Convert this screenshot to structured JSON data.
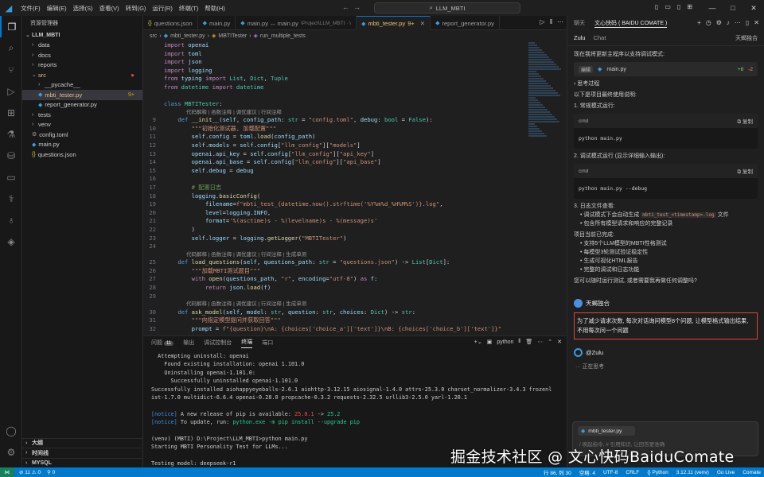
{
  "titlebar": {
    "menu": [
      "文件(F)",
      "编辑(E)",
      "选择(S)",
      "查看(V)",
      "转到(G)",
      "运行(R)",
      "终端(T)",
      "帮助(H)"
    ],
    "search": "LLM_MBTI",
    "window_controls": [
      "—",
      "□",
      "✕"
    ]
  },
  "sidebar": {
    "header": "资源管理器",
    "root": "LLM_MBTI",
    "items": [
      {
        "label": "data",
        "type": "folder",
        "depth": 1
      },
      {
        "label": "docs",
        "type": "folder",
        "depth": 1
      },
      {
        "label": "reports",
        "type": "folder",
        "depth": 1
      },
      {
        "label": "src",
        "type": "folder-open",
        "depth": 1,
        "modified": true
      },
      {
        "label": "__pycache__",
        "type": "folder",
        "depth": 2
      },
      {
        "label": "mbti_tester.py",
        "type": "py",
        "depth": 2,
        "badge": "9+",
        "selected": true
      },
      {
        "label": "report_generator.py",
        "type": "py",
        "depth": 2
      },
      {
        "label": "tests",
        "type": "folder",
        "depth": 1
      },
      {
        "label": "venv",
        "type": "folder",
        "depth": 1
      },
      {
        "label": "config.toml",
        "type": "toml",
        "depth": 1
      },
      {
        "label": "main.py",
        "type": "py",
        "depth": 1
      },
      {
        "label": "questions.json",
        "type": "json",
        "depth": 1
      }
    ],
    "bottom_sections": [
      "大纲",
      "时间线",
      "MYSQL"
    ]
  },
  "tabs": [
    {
      "label": "questions.json",
      "icon": "json-icon",
      "active": false
    },
    {
      "label": "main.py",
      "icon": "py-icon",
      "active": false
    },
    {
      "label": "main.py ↔ main.py",
      "extra": "\\Project\\LLM_MBTI · \\",
      "icon": "py-icon",
      "active": false
    },
    {
      "label": "mbti_tester.py",
      "badge": "9+",
      "icon": "py-icon",
      "active": true
    },
    {
      "label": "report_generator.py",
      "icon": "py-icon",
      "active": false
    }
  ],
  "breadcrumb": [
    "src",
    "mbti_tester.py",
    "MBTITester",
    "run_multiple_tests"
  ],
  "code": {
    "codelens": "代码解释 | 函数注释 | 调优建议 | 行间注释",
    "codelens2": "代码解释 | 函数注释 | 调优建议 | 行间注释 | 生成单测",
    "lines": [
      {
        "n": "",
        "t": "import openai"
      },
      {
        "n": "",
        "t": "import toml"
      },
      {
        "n": "",
        "t": "import json"
      },
      {
        "n": "",
        "t": "import logging"
      },
      {
        "n": "",
        "t": "from typing import List, Dict, Tuple"
      },
      {
        "n": "",
        "t": "from datetime import datetime"
      },
      {
        "n": "",
        "t": ""
      },
      {
        "n": "",
        "t": "class MBTITester:"
      },
      {
        "n": "9",
        "t": "    def __init__(self, config_path: str = \"config.toml\", debug: bool = False):"
      },
      {
        "n": "10",
        "t": "        \"\"\"初始化测试器, 加载配置\"\"\""
      },
      {
        "n": "11",
        "t": "        self.config = toml.load(config_path)"
      },
      {
        "n": "12",
        "t": "        self.models = self.config[\"llm_config\"][\"models\"]"
      },
      {
        "n": "13",
        "t": "        openai.api_key = self.config[\"llm_config\"][\"api_key\"]"
      },
      {
        "n": "14",
        "t": "        openai.api_base = self.config[\"llm_config\"][\"api_base\"]"
      },
      {
        "n": "15",
        "t": "        self.debug = debug"
      },
      {
        "n": "16",
        "t": ""
      },
      {
        "n": "17",
        "t": "        # 配置日志"
      },
      {
        "n": "18",
        "t": "        logging.basicConfig("
      },
      {
        "n": "19",
        "t": "            filename=f\"mbti_test_{datetime.now().strftime('%Y%m%d_%H%M%S')}.log\","
      },
      {
        "n": "20",
        "t": "            level=logging.INFO,"
      },
      {
        "n": "21",
        "t": "            format='%(asctime)s - %(levelname)s - %(message)s'"
      },
      {
        "n": "22",
        "t": "        )"
      },
      {
        "n": "23",
        "t": "        self.logger = logging.getLogger(\"MBTITester\")"
      },
      {
        "n": "24",
        "t": ""
      },
      {
        "n": "25",
        "t": "    def load_questions(self, questions_path: str = \"questions.json\") -> List[Dict]:"
      },
      {
        "n": "26",
        "t": "        \"\"\"加载MBTI测试题目\"\"\""
      },
      {
        "n": "27",
        "t": "        with open(questions_path, \"r\", encoding=\"utf-8\") as f:"
      },
      {
        "n": "28",
        "t": "            return json.load(f)"
      },
      {
        "n": "29",
        "t": ""
      },
      {
        "n": "30",
        "t": "    def ask_model(self, model: str, question: str, choices: Dict) -> str:"
      },
      {
        "n": "31",
        "t": "        \"\"\"向指定模型提问并获取回答\"\"\""
      },
      {
        "n": "32",
        "t": "        prompt = f\"{question}\\nA: {choices['choice_a']['text']}\\nB: {choices['choice_b']['text']}\""
      }
    ]
  },
  "panel": {
    "tabs": [
      "问题",
      "输出",
      "调试控制台",
      "终端",
      "端口"
    ],
    "problem_count": "11",
    "shell": "python",
    "terminal": [
      "  Attempting uninstall: openai",
      "    Found existing installation: openai 1.101.0",
      "    Uninstalling openai-1.101.0:",
      "      Successfully uninstalled openai-1.101.0",
      "Successfully installed aiohappyeyeballs-2.6.1 aiohttp-3.12.15 aiosignal-1.4.0 attrs-25.3.0 charset_normalizer-3.4.3 frozenl",
      "ist-1.7.0 multidict-6.6.4 openai-0.28.0 propcache-0.3.2 requests-2.32.5 urllib3-2.5.0 yarl-1.20.1",
      "",
      "[notice] A new release of pip is available: 25.0.1 -> 25.2",
      "[notice] To update, run: python.exe -m pip install --upgrade pip",
      "",
      "(venv) (MBTI) D:\\Project\\LLM_MBTI>python main.py",
      "Starting MBTI Personality Test for LLMs...",
      "",
      "Testing model: deepseek-r1"
    ]
  },
  "chat": {
    "top_tabs": [
      "聊天",
      "文心快码 ( BAIDU COMATE )"
    ],
    "sub_tabs": [
      "Zulu",
      "Chat"
    ],
    "agent": "天蝎独合",
    "intro": "现在我将更新主程序以支持调试模式:",
    "file_chip": {
      "tag": "编辑",
      "name": "main.py",
      "plus": "+8",
      "minus": "-2"
    },
    "thinking_label": "思考过程",
    "summary": "以下是项目最终使用说明:",
    "step1": "1. 常规模式运行:",
    "step2": "2. 调试模式运行 (显示详细输入输出):",
    "cmd_label": "cmd",
    "copy_label": "复制",
    "cmd1": "python main.py",
    "cmd2": "python main.py --debug",
    "step3": "3. 日志文件查看:",
    "log_bullets": [
      {
        "pre": "调试模式下会自动生成 ",
        "code": "mbti_test_<timestamp>.log",
        "post": " 文件"
      },
      {
        "pre": "包含所有模型请求和响应的完整记录",
        "code": "",
        "post": ""
      }
    ],
    "done_title": "项目当前已完成:",
    "done_bullets": [
      "支持5个LLM模型的MBTI性格测试",
      "每模型3轮测试验证稳定性",
      "生成可视化HTML报告",
      "完整的调试和日志功能"
    ],
    "ask": "您可以随时运行测试, 或者需要我再做任何调整吗?",
    "user_name": "天蝎独合",
    "user_message": "为了减少请求次数, 每次对话询问模型8个问题, 让模型格式输出结果, 不用每次问一个问题",
    "assistant_name": "@Zulu",
    "thinking_now": "··· 正在思考",
    "input_chip": "mbti_tester.py",
    "input_placeholder": "/ 唤起指令, # 引用知识, 让回答更准确"
  },
  "watermark": "掘金技术社区 @ 文心快码BaiduComate",
  "statusbar": {
    "left": [
      "⊘ 11  ⚠ 0",
      "⚲ 0"
    ],
    "right": [
      "行 86, 列 30",
      "空格: 4",
      "UTF-8",
      "CRLF",
      "{} Python",
      "3.12.11 (venv)",
      "Go Live",
      "Comate"
    ]
  }
}
